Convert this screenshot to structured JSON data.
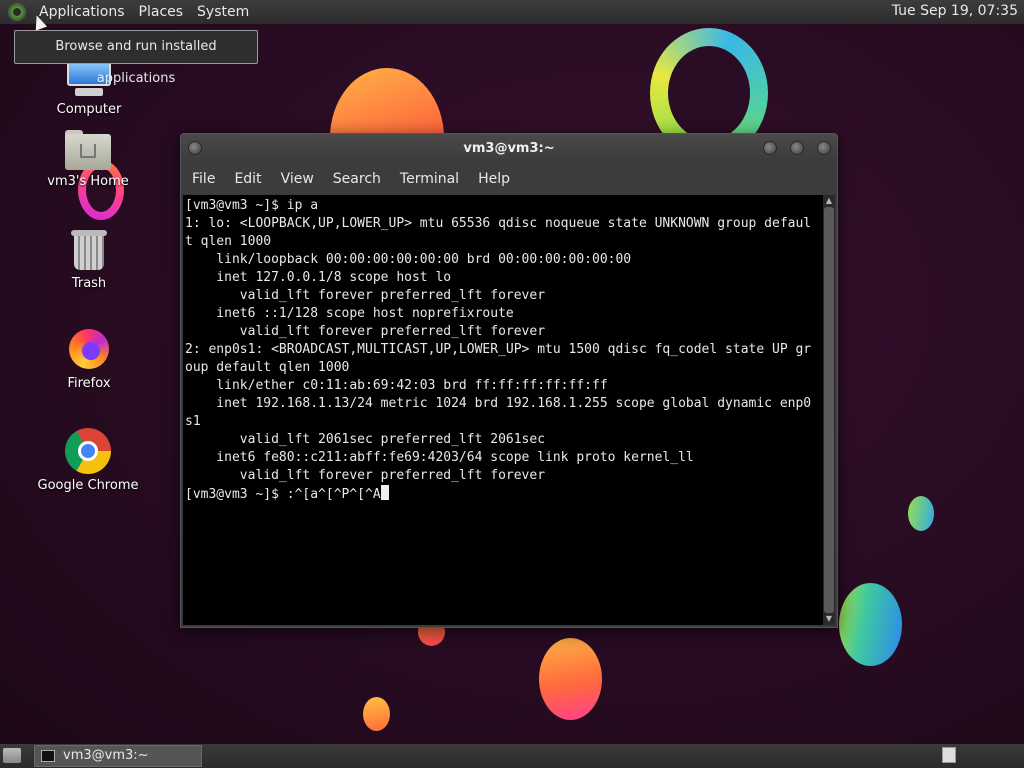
{
  "top_panel": {
    "menus": [
      "Applications",
      "Places",
      "System"
    ],
    "clock": "Tue Sep 19, 07:35"
  },
  "tooltip": "Browse and run installed applications",
  "desktop_icons": [
    {
      "label": "Computer",
      "icon": "computer-icon"
    },
    {
      "label": "vm3's Home",
      "icon": "home-folder-icon"
    },
    {
      "label": "Trash",
      "icon": "trash-icon"
    },
    {
      "label": "Firefox",
      "icon": "firefox-icon"
    },
    {
      "label": "Google Chrome",
      "icon": "chrome-icon"
    }
  ],
  "terminal": {
    "title": "vm3@vm3:~",
    "menu": [
      "File",
      "Edit",
      "View",
      "Search",
      "Terminal",
      "Help"
    ],
    "lines": [
      "[vm3@vm3 ~]$ ip a",
      "1: lo: <LOOPBACK,UP,LOWER_UP> mtu 65536 qdisc noqueue state UNKNOWN group defaul",
      "t qlen 1000",
      "    link/loopback 00:00:00:00:00:00 brd 00:00:00:00:00:00",
      "    inet 127.0.0.1/8 scope host lo",
      "       valid_lft forever preferred_lft forever",
      "    inet6 ::1/128 scope host noprefixroute",
      "       valid_lft forever preferred_lft forever",
      "2: enp0s1: <BROADCAST,MULTICAST,UP,LOWER_UP> mtu 1500 qdisc fq_codel state UP gr",
      "oup default qlen 1000",
      "    link/ether c0:11:ab:69:42:03 brd ff:ff:ff:ff:ff:ff",
      "    inet 192.168.1.13/24 metric 1024 brd 192.168.1.255 scope global dynamic enp0",
      "s1",
      "       valid_lft 2061sec preferred_lft 2061sec",
      "    inet6 fe80::c211:abff:fe69:4203/64 scope link proto kernel_ll",
      "       valid_lft forever preferred_lft forever"
    ],
    "prompt": "[vm3@vm3 ~]$ :^[a^[^P^[^A"
  },
  "bottom_panel": {
    "task_label": "vm3@vm3:~"
  }
}
